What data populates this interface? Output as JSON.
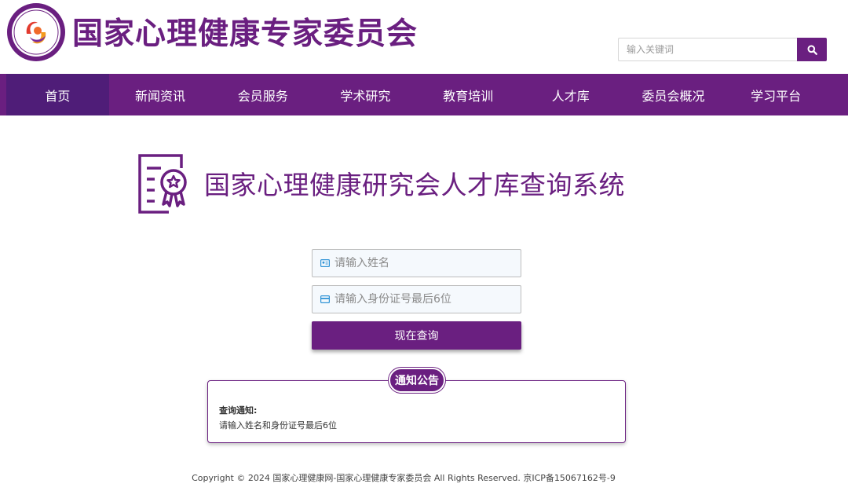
{
  "header": {
    "site_title": "国家心理健康专家委员会",
    "search_placeholder": "输入关键词"
  },
  "nav": {
    "items": [
      {
        "label": "首页",
        "active": true
      },
      {
        "label": "新闻资讯",
        "active": false
      },
      {
        "label": "会员服务",
        "active": false
      },
      {
        "label": "学术研究",
        "active": false
      },
      {
        "label": "教育培训",
        "active": false
      },
      {
        "label": "人才库",
        "active": false
      },
      {
        "label": "委员会概况",
        "active": false
      },
      {
        "label": "学习平台",
        "active": false
      }
    ]
  },
  "main": {
    "title": "国家心理健康研究会人才库查询系统",
    "name_placeholder": "请输入姓名",
    "id_placeholder": "请输入身份证号最后6位",
    "submit_label": "现在查询"
  },
  "notice": {
    "badge": "通知公告",
    "heading": "查询通知:",
    "text": "请输入姓名和身份证号最后6位"
  },
  "footer": {
    "copyright": "Copyright © 2024 国家心理健康网-国家心理健康专家委员会 All Rights Reserved. 京ICP备15067162号-9"
  },
  "colors": {
    "brand": "#6a1f80",
    "nav_active": "#4f1d78",
    "icon_blue": "#2f93d6"
  },
  "icons": [
    "logo-emblem",
    "search-icon",
    "certificate-icon",
    "id-card-icon",
    "card-icon"
  ]
}
